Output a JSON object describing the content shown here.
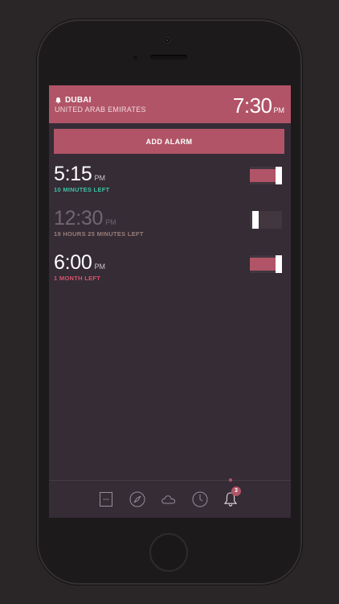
{
  "header": {
    "city": "DUBAI",
    "country": "UNITED ARAB EMIRATES",
    "time": "7:30",
    "ampm": "PM"
  },
  "add_alarm_label": "ADD ALARM",
  "alarms": [
    {
      "time": "5:15",
      "ampm": "PM",
      "left": "10 MINUTES LEFT",
      "enabled": true
    },
    {
      "time": "12:30",
      "ampm": "PM",
      "left": "19 HOURS 25 MINUTES LEFT",
      "enabled": false
    },
    {
      "time": "6:00",
      "ampm": "PM",
      "left": "1 MONTH LEFT",
      "enabled": true
    }
  ],
  "tabbar": {
    "tabs": [
      {
        "icon": "calendar-icon"
      },
      {
        "icon": "compass-icon"
      },
      {
        "icon": "cloud-icon"
      },
      {
        "icon": "clock-icon"
      },
      {
        "icon": "bell-icon",
        "badge": "3",
        "active": true
      }
    ]
  },
  "colors": {
    "accent": "#b15467",
    "background": "#352c36",
    "teal": "#3ec2a2",
    "muted": "#9a7e78",
    "red": "#d8546b"
  }
}
